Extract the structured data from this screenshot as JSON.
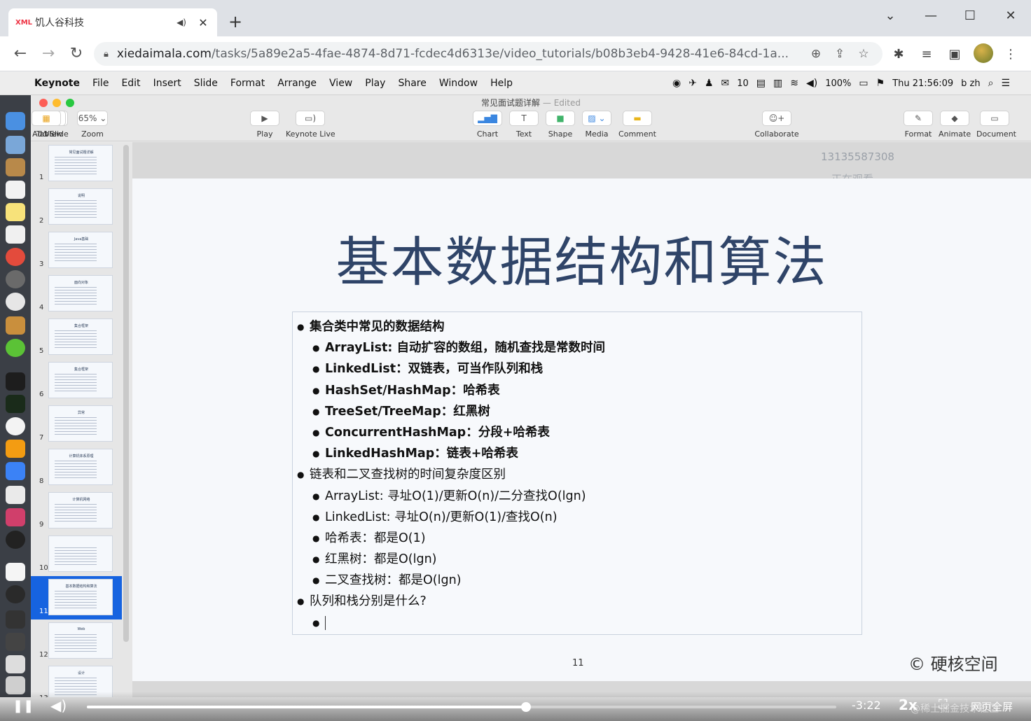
{
  "browser": {
    "tab_title": "饥人谷科技",
    "tab_favicon": "XML",
    "url_host": "xiedaimala.com",
    "url_path": "/tasks/5a89e2a5-4fae-4874-8d71-fcdec4d6313e/video_tutorials/b08b3eb4-9428-41e6-84cd-1a..."
  },
  "mac_menu": {
    "app": "Keynote",
    "items": [
      "File",
      "Edit",
      "Insert",
      "Slide",
      "Format",
      "Arrange",
      "View",
      "Play",
      "Share",
      "Window",
      "Help"
    ],
    "status": {
      "wechat_count": "10",
      "battery": "100%",
      "clock": "Thu 21:56:09",
      "user": "b zh"
    }
  },
  "keynote": {
    "doc_title": "常见面试题详解",
    "edited": "— Edited",
    "toolbar": {
      "view": "View",
      "zoom_value": "65%",
      "zoom": "Zoom",
      "add_slide": "Add Slide",
      "play": "Play",
      "keynote_live": "Keynote Live",
      "table": "Table",
      "chart": "Chart",
      "text": "Text",
      "shape": "Shape",
      "media": "Media",
      "comment": "Comment",
      "collaborate": "Collaborate",
      "format": "Format",
      "animate": "Animate",
      "document": "Document"
    },
    "thumbnails": [
      {
        "num": "1",
        "title": "常见面试题详解"
      },
      {
        "num": "2",
        "title": "说明"
      },
      {
        "num": "3",
        "title": "Java基础"
      },
      {
        "num": "4",
        "title": "面向对象"
      },
      {
        "num": "5",
        "title": "集合框架"
      },
      {
        "num": "6",
        "title": "集合框架"
      },
      {
        "num": "7",
        "title": "异常"
      },
      {
        "num": "8",
        "title": "计算机体系原理"
      },
      {
        "num": "9",
        "title": "计算机网络"
      },
      {
        "num": "10",
        "title": ""
      },
      {
        "num": "11",
        "title": "基本数据结构和算法"
      },
      {
        "num": "12",
        "title": "Web"
      },
      {
        "num": "13",
        "title": "设计"
      }
    ],
    "selected_slide": "11"
  },
  "overlay": {
    "phone": "13135587308",
    "watching": "正在观看"
  },
  "slide": {
    "title": "基本数据结构和算法",
    "bullets": [
      {
        "level": 1,
        "bold": true,
        "text": "集合类中常见的数据结构"
      },
      {
        "level": 2,
        "bold": true,
        "text": "ArrayList: 自动扩容的数组，随机查找是常数时间"
      },
      {
        "level": 2,
        "bold": true,
        "text": "LinkedList：双链表，可当作队列和栈"
      },
      {
        "level": 2,
        "bold": true,
        "text": "HashSet/HashMap：哈希表"
      },
      {
        "level": 2,
        "bold": true,
        "text": "TreeSet/TreeMap：红黑树"
      },
      {
        "level": 2,
        "bold": true,
        "text": "ConcurrentHashMap：分段+哈希表"
      },
      {
        "level": 2,
        "bold": true,
        "text": "LinkedHashMap：链表+哈希表"
      },
      {
        "level": 1,
        "bold": false,
        "text": "链表和二叉查找树的时间复杂度区别"
      },
      {
        "level": 2,
        "bold": false,
        "text": "ArrayList: 寻址O(1)/更新O(n)/二分查找O(lgn)"
      },
      {
        "level": 2,
        "bold": false,
        "text": "LinkedList: 寻址O(n)/更新O(1)/查找O(n)"
      },
      {
        "level": 2,
        "bold": false,
        "text": "哈希表：都是O(1)"
      },
      {
        "level": 2,
        "bold": false,
        "text": "红黑树：都是O(lgn)"
      },
      {
        "level": 2,
        "bold": false,
        "text": "二叉查找树：都是O(lgn)"
      },
      {
        "level": 1,
        "bold": false,
        "text": "队列和栈分别是什么?"
      },
      {
        "level": 2,
        "bold": false,
        "text": ""
      }
    ],
    "number": "11",
    "copyright": "© 硬核空间"
  },
  "player": {
    "time_remaining": "-3:22",
    "speed": "2x",
    "web_fullscreen": "网页全屏",
    "progress": 0.586,
    "watermark": "@稀土掘金技术社区"
  },
  "colors": {
    "selected": "#1663e0",
    "title": "#2f4468"
  }
}
